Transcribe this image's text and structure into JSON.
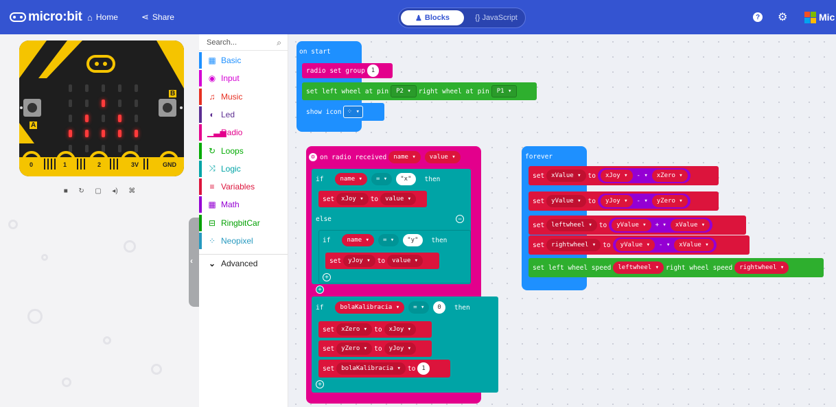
{
  "app": {
    "brand": "micro:bit",
    "home_label": "Home",
    "share_label": "Share",
    "blocks_label": "Blocks",
    "javascript_label": "{} JavaScript",
    "ms_label": "Mic",
    "help_icon": "?",
    "settings_icon": "⚙"
  },
  "simulator": {
    "pins": [
      "0",
      "1",
      "2",
      "3V",
      "GND"
    ],
    "button_a": "A",
    "button_b": "B",
    "led_rows": [
      [
        0,
        0,
        0,
        0,
        0
      ],
      [
        0,
        0,
        1,
        0,
        0
      ],
      [
        0,
        1,
        0,
        1,
        0
      ],
      [
        1,
        1,
        1,
        1,
        1
      ],
      [
        0,
        0,
        0,
        0,
        0
      ]
    ],
    "controls": [
      "■",
      "↻",
      "▢",
      "◂)",
      "⌘"
    ]
  },
  "toolbox": {
    "search_placeholder": "Search...",
    "categories": [
      {
        "label": "Basic",
        "icon": "▦",
        "color": "#1e90ff"
      },
      {
        "label": "Input",
        "icon": "◉",
        "color": "#d400d4"
      },
      {
        "label": "Music",
        "icon": "♫",
        "color": "#e63022"
      },
      {
        "label": "Led",
        "icon": "◐",
        "color": "#5c2d91"
      },
      {
        "label": "Radio",
        "icon": "▁▃▅",
        "color": "#e3008c"
      },
      {
        "label": "Loops",
        "icon": "↻",
        "color": "#00aa00"
      },
      {
        "label": "Logic",
        "icon": "⤨",
        "color": "#00a4a6"
      },
      {
        "label": "Variables",
        "icon": "≡",
        "color": "#dc143c"
      },
      {
        "label": "Math",
        "icon": "▦",
        "color": "#9400d3"
      },
      {
        "label": "RingbitCar",
        "icon": "⊟",
        "color": "#00a000"
      },
      {
        "label": "Neopixel",
        "icon": "⁘",
        "color": "#2699bf"
      }
    ],
    "advanced_label": "Advanced"
  },
  "blocks": {
    "on_start": {
      "title": "on start",
      "radio_set_group": "radio set group",
      "group_value": "1",
      "set_left_wheel": "set left wheel at pin",
      "left_pin": "P2 ▾",
      "right_wheel": "right wheel at pin",
      "right_pin": "P1 ▾",
      "show_icon": "show icon"
    },
    "on_radio": {
      "title": "on radio received",
      "name": "name ▾",
      "value": "value ▾",
      "if": "if",
      "then": "then",
      "else": "else",
      "eq": "= ▾",
      "x_str": "\"x\"",
      "y_str": "\"y\"",
      "set": "set",
      "to": "to",
      "xJoy": "xJoy ▾",
      "yJoy": "yJoy ▾",
      "bolaKalibracia": "bolaKalibracia ▾",
      "zero": "0",
      "one": "1",
      "xZero": "xZero ▾",
      "yZero": "yZero ▾"
    },
    "forever": {
      "title": "forever",
      "xValue": "xValue ▾",
      "yValue": "yValue ▾",
      "leftwheel": "leftwheel ▾",
      "rightwheel": "rightwheel ▾",
      "minus": "- ▾",
      "plus": "+ ▾",
      "set_speed": "set left wheel speed",
      "right_speed": "right wheel speed"
    }
  },
  "colors": {
    "topbar": "#3454d1",
    "radio": "#e3008c",
    "variables": "#dc143c",
    "logic": "#00a4a6",
    "loops_blue": "#1e90ff",
    "green": "#2eaf2e",
    "math": "#9400d3"
  }
}
